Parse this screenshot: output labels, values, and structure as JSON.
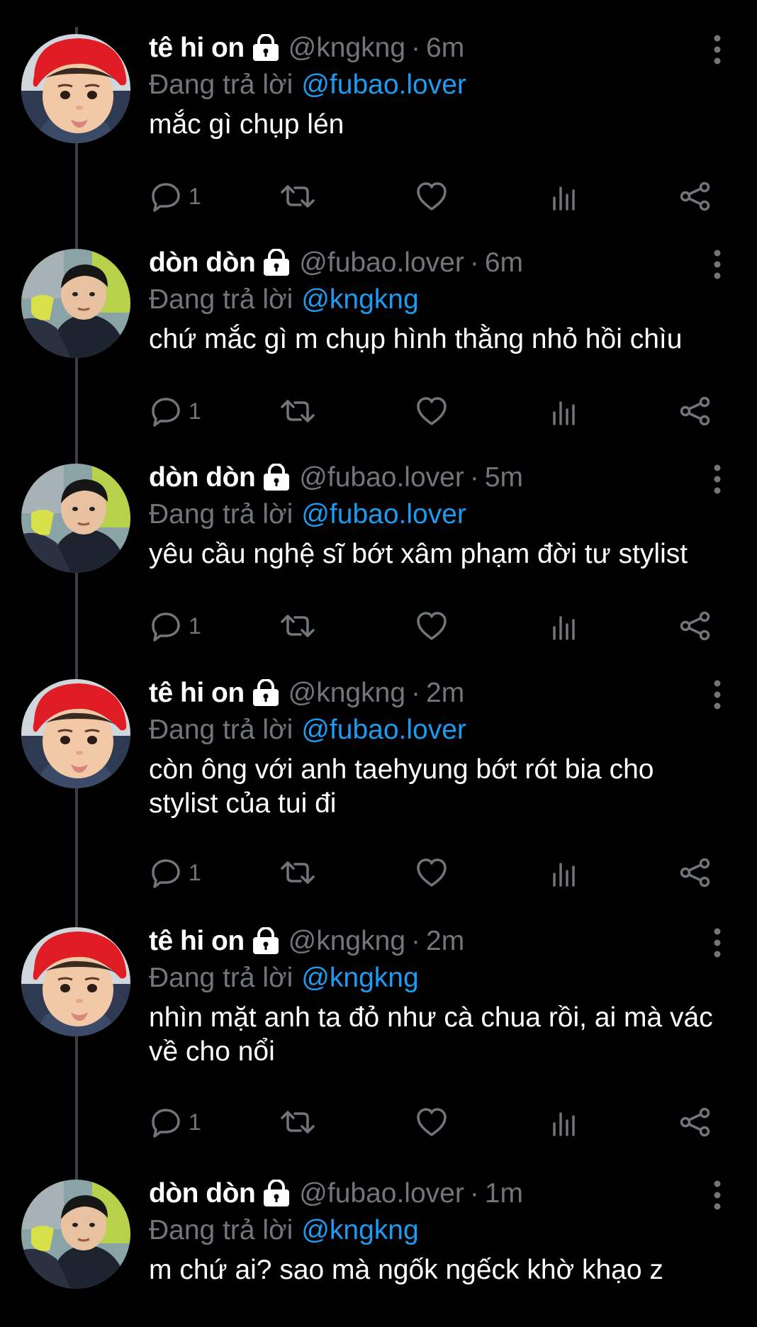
{
  "colors": {
    "background": "#000000",
    "name": "#ffffff",
    "muted": "#71767b",
    "link": "#1d9bf0",
    "thread_line": "#3a3d41"
  },
  "tweets": [
    {
      "name": "tê hi on",
      "handle": "@kngkng",
      "separator": "·",
      "time": "6m",
      "reply_label": "Đang trả lời",
      "reply_to": "@fubao.lover",
      "text": "mắc gì chụp lén",
      "reply_count": "1",
      "avatar": "red-hat-kid-avatar"
    },
    {
      "name": "dòn dòn",
      "handle": "@fubao.lover",
      "separator": "·",
      "time": "6m",
      "reply_label": "Đang trả lời",
      "reply_to": "@kngkng",
      "text": "chứ mắc gì m chụp hình thằng nhỏ hồi chìu",
      "reply_count": "1",
      "avatar": "kid-in-jacket-avatar"
    },
    {
      "name": "dòn dòn",
      "handle": "@fubao.lover",
      "separator": "·",
      "time": "5m",
      "reply_label": "Đang trả lời",
      "reply_to": "@fubao.lover",
      "text": "yêu cầu nghệ sĩ bớt xâm phạm đời tư stylist",
      "reply_count": "1",
      "avatar": "kid-in-jacket-avatar"
    },
    {
      "name": "tê hi on",
      "handle": "@kngkng",
      "separator": "·",
      "time": "2m",
      "reply_label": "Đang trả lời",
      "reply_to": "@fubao.lover",
      "text": "còn ông với anh taehyung bớt rót bia cho stylist của tui đi",
      "reply_count": "1",
      "avatar": "red-hat-kid-avatar"
    },
    {
      "name": "tê hi on",
      "handle": "@kngkng",
      "separator": "·",
      "time": "2m",
      "reply_label": "Đang trả lời",
      "reply_to": "@kngkng",
      "text": "nhìn mặt anh ta đỏ như cà chua rồi, ai mà vác về cho nổi",
      "reply_count": "1",
      "avatar": "red-hat-kid-avatar"
    },
    {
      "name": "dòn dòn",
      "handle": "@fubao.lover",
      "separator": "·",
      "time": "1m",
      "reply_label": "Đang trả lời",
      "reply_to": "@kngkng",
      "text": "m chứ ai? sao mà ngốk ngếck khờ khạo z",
      "reply_count": "",
      "avatar": "kid-in-jacket-avatar"
    }
  ]
}
